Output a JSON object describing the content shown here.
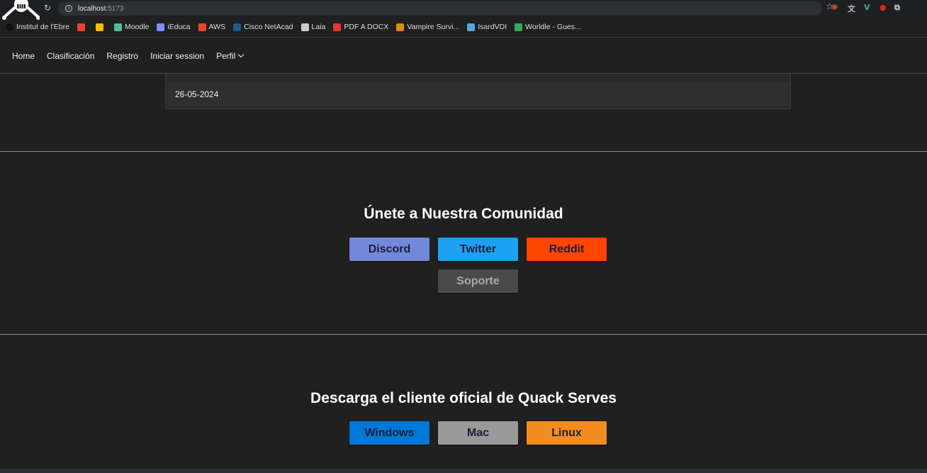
{
  "browser": {
    "url_host": "localhost",
    "url_port": ":5173",
    "bookmarks": [
      {
        "label": "Institut de l'Ebre",
        "icon": "circle-icon",
        "color": "#111111"
      },
      {
        "label": "",
        "icon": "gmail-icon",
        "color": "#ea4335"
      },
      {
        "label": "",
        "icon": "drive-icon",
        "color": "#fbbc04"
      },
      {
        "label": "Moodle",
        "icon": "moodle-icon",
        "color": "#4fbf8f"
      },
      {
        "label": "iEduca",
        "icon": "ieduca-icon",
        "color": "#7d8cff"
      },
      {
        "label": "AWS",
        "icon": "aws-icon",
        "color": "#e8472b"
      },
      {
        "label": "Cisco NetAcad",
        "icon": "cisco-icon",
        "color": "#1b5b8c"
      },
      {
        "label": "Laia",
        "icon": "laia-icon",
        "color": "#cccccc"
      },
      {
        "label": "PDF A DOCX",
        "icon": "pdf-icon",
        "color": "#e03b2f"
      },
      {
        "label": "Vampire Survi...",
        "icon": "vampire-icon",
        "color": "#e08a16"
      },
      {
        "label": "IsardVDI",
        "icon": "isard-icon",
        "color": "#58a6d8"
      },
      {
        "label": "Worldle - Gues...",
        "icon": "globe-icon",
        "color": "#3aa65a"
      }
    ]
  },
  "nav": {
    "items": [
      "Home",
      "Clasificación",
      "Registro",
      "Iniciar session",
      "Perfil"
    ]
  },
  "card": {
    "date": "26-05-2024"
  },
  "community": {
    "title": "Únete a Nuestra Comunidad",
    "buttons": [
      {
        "label": "Discord",
        "color": "#7289da"
      },
      {
        "label": "Twitter",
        "color": "#1da1f2"
      },
      {
        "label": "Reddit",
        "color": "#ff4500"
      },
      {
        "label": "Soporte",
        "color": "#4a4a4a"
      }
    ]
  },
  "download": {
    "title": "Descarga el cliente oficial de Quack Serves",
    "buttons": [
      {
        "label": "Windows",
        "color": "#0078d7"
      },
      {
        "label": "Mac",
        "color": "#999999"
      },
      {
        "label": "Linux",
        "color": "#f28c20"
      }
    ]
  }
}
